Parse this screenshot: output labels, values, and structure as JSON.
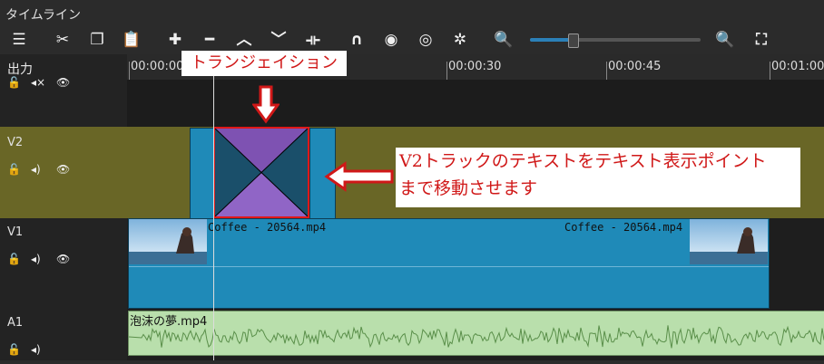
{
  "window": {
    "title": "タイムライン"
  },
  "toolbar": {
    "icons": [
      "menu-icon",
      "cut-icon",
      "copy-icon",
      "paste-icon",
      "append-icon",
      "remove-icon",
      "lift-icon",
      "overwrite-icon",
      "split-icon",
      "snap-icon",
      "scrub-icon",
      "ripple-icon",
      "ripple-all-icon",
      "zoom-out-icon",
      "zoom-in-icon",
      "zoom-fit-icon"
    ],
    "zoom_level": 0.25
  },
  "timeline": {
    "output_label": "出力",
    "ruler": [
      "00:00:00",
      "00:00:30",
      "00:00:45",
      "00:01:00"
    ]
  },
  "tracks": [
    {
      "name": "V2"
    },
    {
      "name": "V1"
    },
    {
      "name": "A1"
    }
  ],
  "clips": {
    "v1_clip_label_left": "Coffee - 20564.mp4",
    "v1_clip_label_right": "Coffee - 20564.mp4",
    "a1_clip_label": "泡沫の夢.mp4"
  },
  "annotations": {
    "transition_label": "トランジェイション",
    "instruction_line1": "V2トラックのテキストをテキスト表示ポイント",
    "instruction_line2": "まで移動させます"
  },
  "colors": {
    "v2_track_bg": "#696626",
    "video_clip": "#1f8ab8",
    "audio_clip": "#b9dfac",
    "annotation_red": "#d01818"
  }
}
